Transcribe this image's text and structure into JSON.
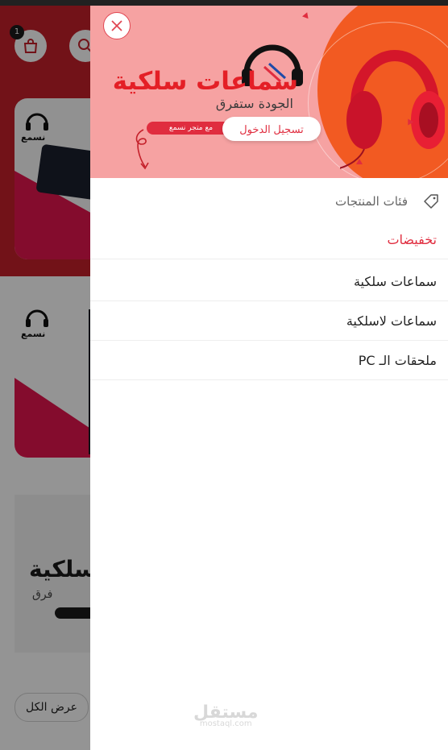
{
  "cart": {
    "count": "1"
  },
  "drawer": {
    "close_label": "×",
    "promo": {
      "brand": "نسمع",
      "title": "سماعات سلكية",
      "subtitle": "الجودة ستفرق",
      "pill_text": "مع متجر نسمع",
      "login_label": "تسجيل الدخول"
    },
    "categories_title": "فئات المنتجات",
    "menu_items": [
      {
        "label": "تخفيضات",
        "color": "#e02d3f"
      },
      {
        "label": "سماعات سلكية"
      },
      {
        "label": "سماعات لاسلكية"
      },
      {
        "label": "ملحقات الـ PC"
      }
    ]
  },
  "background": {
    "card_brand": "نسمع",
    "banner_title": "سلكية",
    "banner_sub": "فرق",
    "view_all_label": "عرض الكل"
  },
  "watermark": {
    "main": "مستقل",
    "sub": "mostaql.com"
  },
  "colors": {
    "accent": "#e02d3f",
    "header_red": "#c4202a",
    "promo_bg": "#f6a2a2",
    "promo_orange": "#f25a22"
  }
}
